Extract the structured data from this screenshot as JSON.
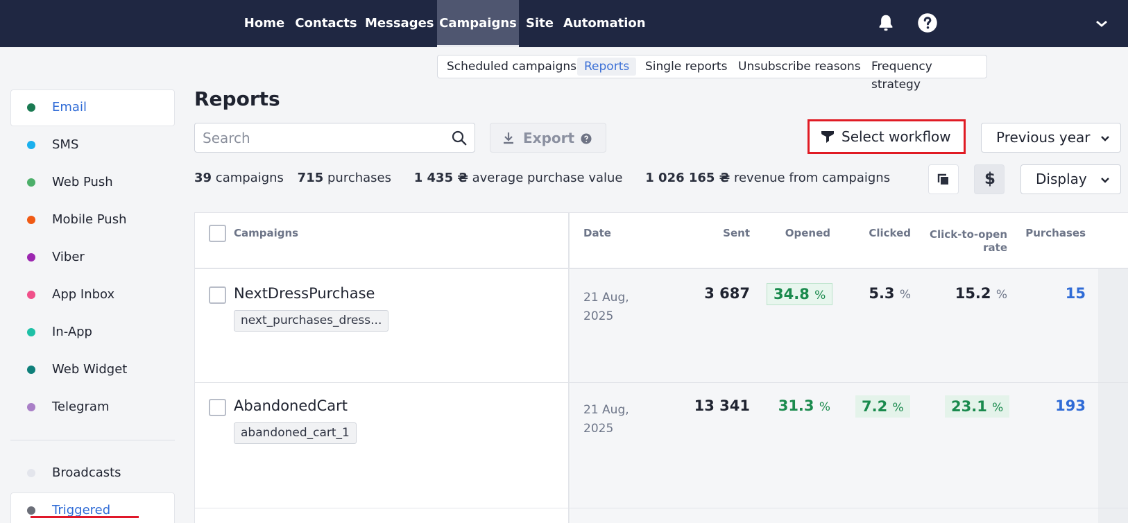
{
  "nav": {
    "items": [
      "Home",
      "Contacts",
      "Messages",
      "Campaigns",
      "Site",
      "Automation"
    ],
    "active": "Campaigns",
    "icons": [
      "bell-icon",
      "help-icon",
      "chevron-down-icon"
    ]
  },
  "subtabs": {
    "items": [
      "Scheduled campaigns",
      "Reports",
      "Single reports",
      "Unsubscribe reasons",
      "Frequency strategy"
    ],
    "active": "Reports"
  },
  "sidebar": {
    "channels": [
      {
        "label": "Email",
        "color": "#1a7a52",
        "active": true
      },
      {
        "label": "SMS",
        "color": "#1ab0ee"
      },
      {
        "label": "Web Push",
        "color": "#4caf6a"
      },
      {
        "label": "Mobile Push",
        "color": "#f05a14"
      },
      {
        "label": "Viber",
        "color": "#9c27b0"
      },
      {
        "label": "App Inbox",
        "color": "#f0508a"
      },
      {
        "label": "In-App",
        "color": "#1ec0a6"
      },
      {
        "label": "Web Widget",
        "color": "#0e7f7a"
      },
      {
        "label": "Telegram",
        "color": "#a97fc7"
      }
    ],
    "types": [
      {
        "label": "Broadcasts",
        "color": "#e3e5ec"
      },
      {
        "label": "Triggered",
        "color": "#6b6e78",
        "active": true
      }
    ]
  },
  "main": {
    "title": "Reports",
    "search_placeholder": "Search",
    "export_label": "Export",
    "workflow_label": "Select workflow",
    "period_label": "Previous year",
    "display_label": "Display",
    "currency_symbol": "$"
  },
  "stats": {
    "campaigns_value": "39",
    "campaigns_label": "campaigns",
    "purchases_value": "715",
    "purchases_label": "purchases",
    "avg_value": "1 435 ₴",
    "avg_label": "average purchase value",
    "revenue_value": "1 026 165 ₴",
    "revenue_label": "revenue from campaigns"
  },
  "table": {
    "headers": {
      "campaigns": "Campaigns",
      "date": "Date",
      "sent": "Sent",
      "opened": "Opened",
      "clicked": "Clicked",
      "cto_line1": "Click-to-open",
      "cto_line2": "rate",
      "purchases": "Purchases"
    },
    "rows": [
      {
        "name": "NextDressPurchase",
        "tag": "next_purchases_dress...",
        "date1": "21 Aug,",
        "date2": "2025",
        "sent": "3 687",
        "opened": "34.8",
        "clicked": "5.3",
        "cto": "15.2",
        "purchases": "15"
      },
      {
        "name": "AbandonedCart",
        "tag": "abandoned_cart_1",
        "date1": "21 Aug,",
        "date2": "2025",
        "sent": "13 341",
        "opened": "31.3",
        "clicked": "7.2",
        "cto": "23.1",
        "purchases": "193"
      }
    ],
    "percent_sign": "%"
  }
}
